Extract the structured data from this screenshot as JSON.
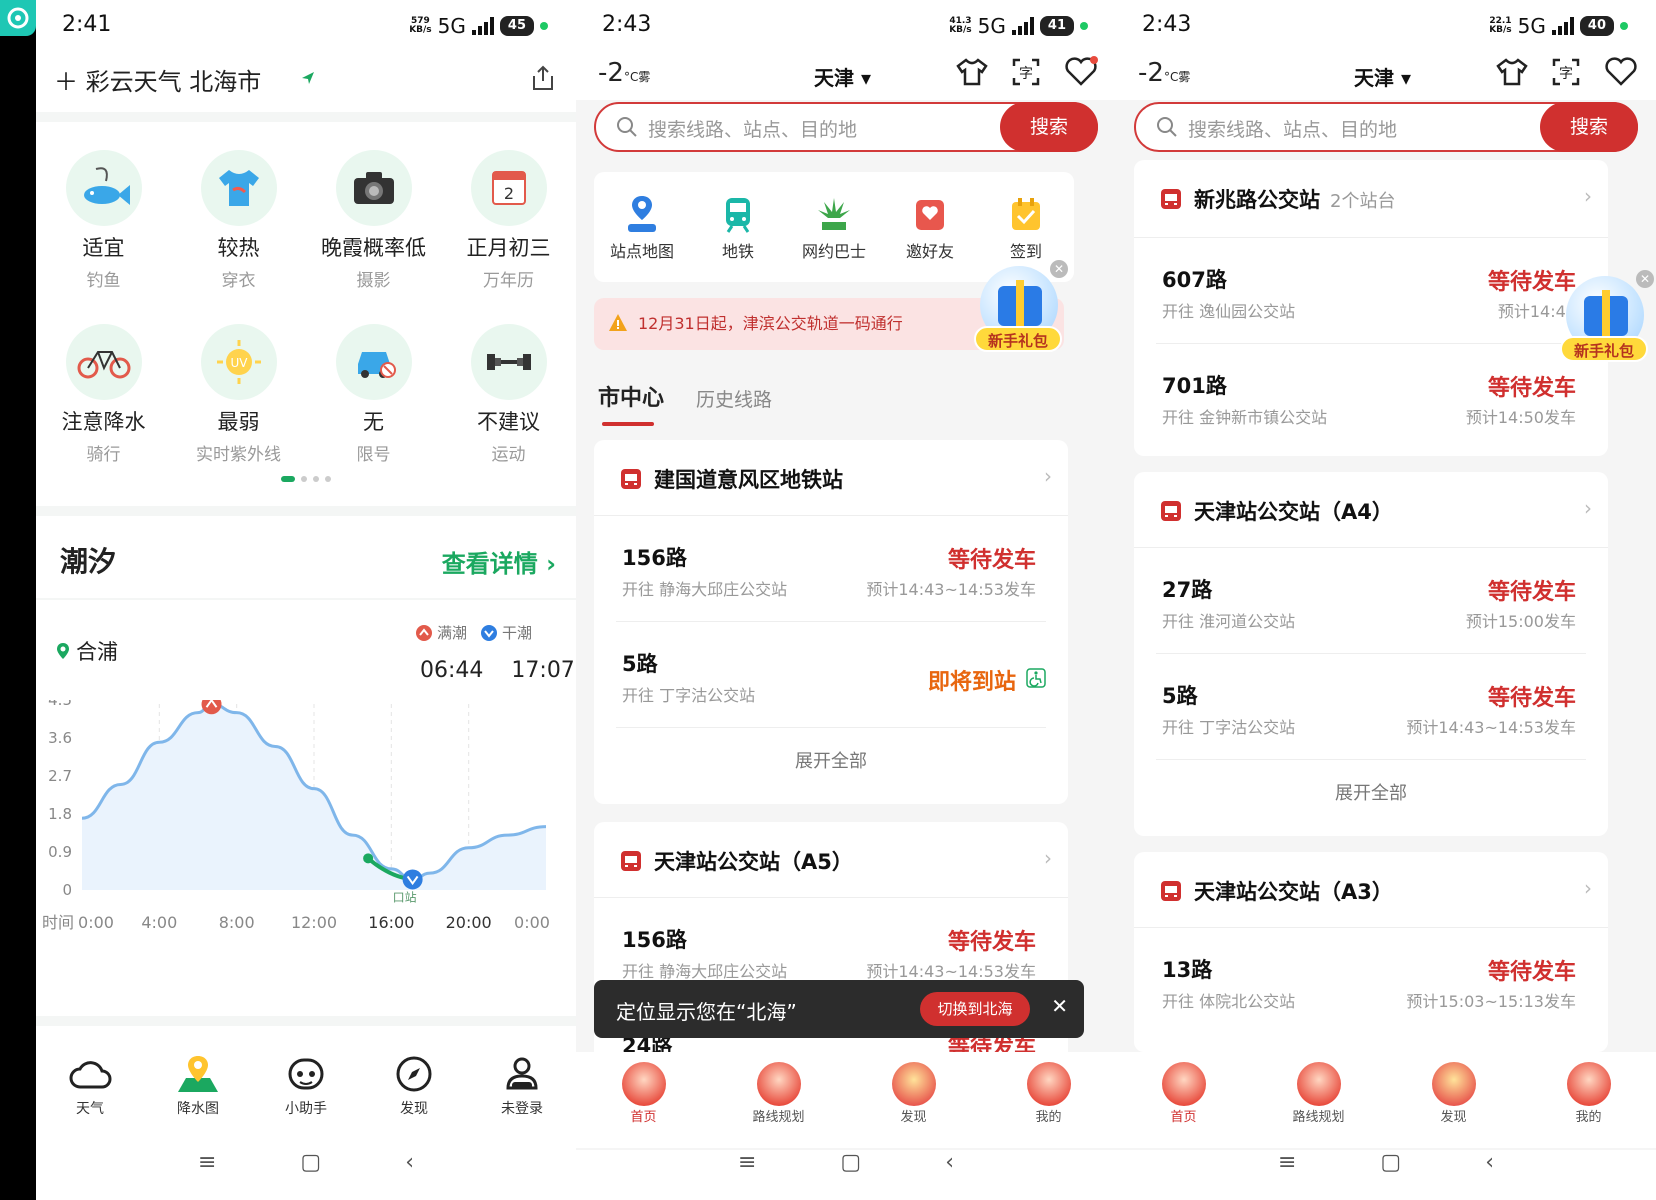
{
  "panels": {
    "weather": {
      "status": {
        "time": "2:41",
        "speed_top": "579",
        "speed_bottom": "KB/s",
        "network": "5G",
        "battery": "45"
      },
      "header": {
        "title": "＋ 彩云天气  北海市"
      },
      "grid": [
        {
          "title": "适宜",
          "sub": "钓鱼",
          "icon": "fishing-icon"
        },
        {
          "title": "较热",
          "sub": "穿衣",
          "icon": "tshirt-icon"
        },
        {
          "title": "晚霞概率低",
          "sub": "摄影",
          "icon": "camera-icon"
        },
        {
          "title": "正月初三",
          "sub": "万年历",
          "icon": "calendar-icon"
        },
        {
          "title": "注意降水",
          "sub": "骑行",
          "icon": "bicycle-icon"
        },
        {
          "title": "最弱",
          "sub": "实时紫外线",
          "icon": "uv-icon"
        },
        {
          "title": "无",
          "sub": "限号",
          "icon": "car-icon"
        },
        {
          "title": "不建议",
          "sub": "运动",
          "icon": "dumbbell-icon"
        }
      ],
      "tide": {
        "title": "潮汐",
        "more": "查看详情 ›",
        "location": "合浦",
        "legend_high": "满潮",
        "legend_low": "干潮",
        "time_high": "06:44",
        "time_low": "17:07",
        "now_label": "口站"
      },
      "nav": [
        {
          "label": "天气",
          "icon": "cloud-icon"
        },
        {
          "label": "降水图",
          "icon": "map-pin-icon"
        },
        {
          "label": "小助手",
          "icon": "assistant-icon"
        },
        {
          "label": "发现",
          "icon": "compass-icon"
        },
        {
          "label": "未登录",
          "icon": "user-icon"
        }
      ]
    },
    "bus1": {
      "status": {
        "time": "2:43",
        "speed_top": "41.3",
        "speed_bottom": "KB/s",
        "network": "5G",
        "battery": "41"
      },
      "temp": "-2",
      "temp_unit": "°C",
      "weather": "雾",
      "city": "天津 ▾",
      "search_placeholder": "搜索线路、站点、目的地",
      "search_button": "搜索",
      "quick": [
        {
          "label": "站点地图",
          "icon": "station-map-icon"
        },
        {
          "label": "地铁",
          "icon": "subway-icon"
        },
        {
          "label": "网约巴士",
          "icon": "green-traffic-icon"
        },
        {
          "label": "邀好友",
          "icon": "invite-icon"
        },
        {
          "label": "签到",
          "icon": "checkin-icon"
        }
      ],
      "notice": "12月31日起，津滨公交轨道一码通行",
      "gift_label": "新手礼包",
      "tabs": [
        "市中心",
        "历史线路"
      ],
      "cards": [
        {
          "name": "建国道意风区地铁站",
          "routes": [
            {
              "name": "156路",
              "dest": "开往 静海大邱庄公交站",
              "status": "等待发车",
              "time": "预计14:43~14:53发车"
            },
            {
              "name": "5路",
              "dest": "开往 丁字沽公交站",
              "status": "即将到站",
              "time": ""
            }
          ],
          "expand": "展开全部"
        },
        {
          "name": "天津站公交站（A5）",
          "routes": [
            {
              "name": "156路",
              "dest": "开往 静海大邱庄公交站",
              "status": "等待发车",
              "time": "预计14:43~14:53发车"
            },
            {
              "name": "24路",
              "dest": "",
              "status": "等待发车",
              "time": ""
            }
          ]
        }
      ],
      "toast": {
        "message": "定位显示您在“北海”",
        "button": "切换到北海",
        "close": "✕"
      },
      "nav": [
        {
          "label": "首页"
        },
        {
          "label": "路线规划"
        },
        {
          "label": "发现"
        },
        {
          "label": "我的"
        }
      ]
    },
    "bus2": {
      "status": {
        "time": "2:43",
        "speed_top": "22.1",
        "speed_bottom": "KB/s",
        "network": "5G",
        "battery": "40"
      },
      "temp": "-2",
      "temp_unit": "°C",
      "weather": "雾",
      "city": "天津 ▾",
      "search_placeholder": "搜索线路、站点、目的地",
      "search_button": "搜索",
      "gift_label": "新手礼包",
      "cards": [
        {
          "name": "新兆路公交站",
          "count": "2个站台",
          "routes": [
            {
              "name": "607路",
              "dest": "开往 逸仙园公交站",
              "status": "等待发车",
              "time": "预计14:45"
            },
            {
              "name": "701路",
              "dest": "开往 金钟新市镇公交站",
              "status": "等待发车",
              "time": "预计14:50发车"
            }
          ]
        },
        {
          "name": "天津站公交站（A4）",
          "routes": [
            {
              "name": "27路",
              "dest": "开往 淮河道公交站",
              "status": "等待发车",
              "time": "预计15:00发车"
            },
            {
              "name": "5路",
              "dest": "开往 丁字沽公交站",
              "status": "等待发车",
              "time": "预计14:43~14:53发车"
            }
          ],
          "expand": "展开全部"
        },
        {
          "name": "天津站公交站（A3）",
          "routes": [
            {
              "name": "13路",
              "dest": "开往 体院北公交站",
              "status": "等待发车",
              "time": "预计15:03~15:13发车"
            }
          ]
        }
      ],
      "nav": [
        {
          "label": "首页"
        },
        {
          "label": "路线规划"
        },
        {
          "label": "发现"
        },
        {
          "label": "我的"
        }
      ]
    }
  },
  "chart_data": {
    "type": "area",
    "title": "潮汐",
    "x_labels": [
      "0:00",
      "4:00",
      "8:00",
      "12:00",
      "16:00",
      "20:00",
      "0:00"
    ],
    "x_axis_label": "时间",
    "y_ticks": [
      "4.5",
      "3.6",
      "2.7",
      "1.8",
      "0.9",
      "0"
    ],
    "ylim": [
      0,
      4.5
    ],
    "x": [
      0,
      2,
      4,
      6,
      6.7,
      8,
      10,
      12,
      14,
      16,
      17.1,
      18,
      20,
      22,
      24
    ],
    "y": [
      1.7,
      2.5,
      3.5,
      4.2,
      4.4,
      4.2,
      3.4,
      2.4,
      1.3,
      0.5,
      0.25,
      0.4,
      1.0,
      1.3,
      1.5
    ],
    "high_tide": {
      "x": 6.7,
      "y": 4.4
    },
    "low_tide": {
      "x": 17.1,
      "y": 0.25
    },
    "colors": {
      "line": "#7fb6ea",
      "fill": "#eaf3fd",
      "highlight": "#1ba860",
      "high": "#e25a4b",
      "low": "#2f7ee0"
    }
  }
}
